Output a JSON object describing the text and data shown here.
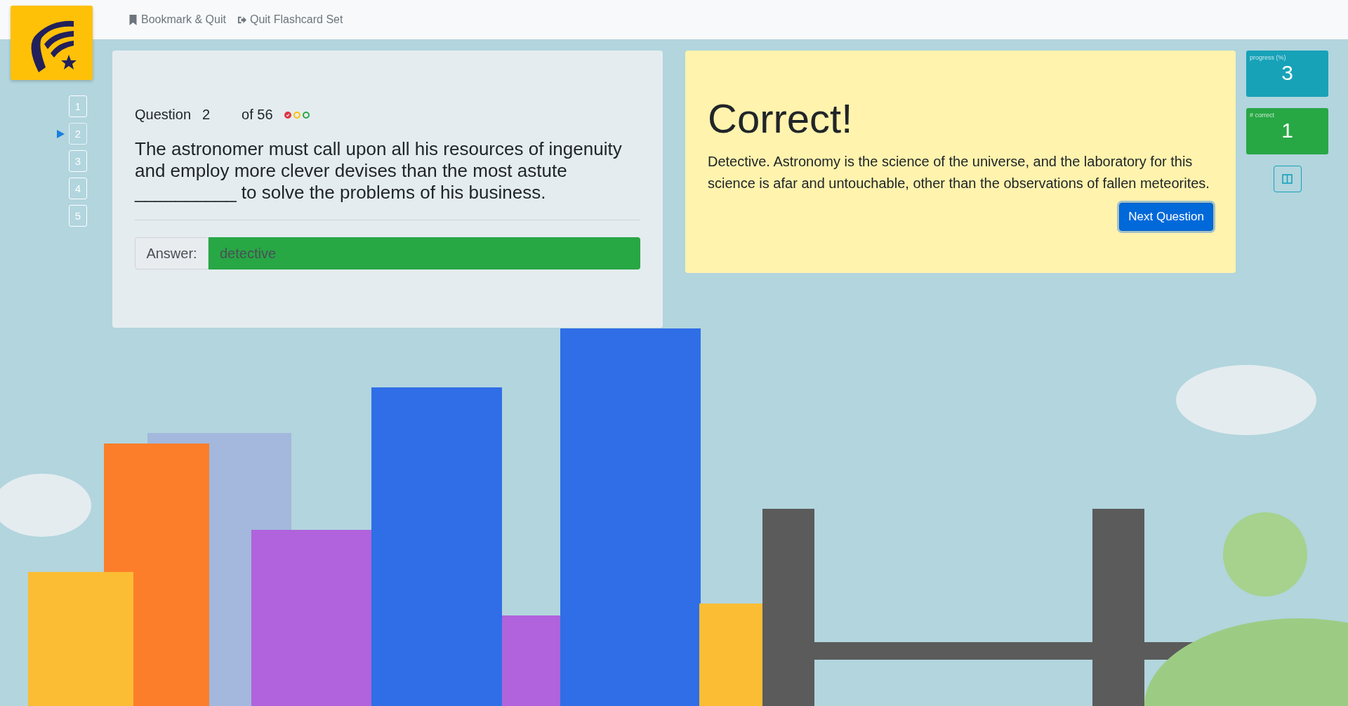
{
  "nav": [
    {
      "kind": "bookmark",
      "label": "Bookmark & Quit"
    },
    {
      "kind": "exit",
      "label": "Quit Flashcard Set"
    }
  ],
  "question_list": [
    {
      "label": "1",
      "selected": false
    },
    {
      "label": "2",
      "selected": true
    },
    {
      "label": "3",
      "selected": false
    },
    {
      "label": "4",
      "selected": false
    },
    {
      "label": "5",
      "selected": false
    }
  ],
  "question": {
    "label": "Question",
    "number": "2",
    "total": "of 56",
    "confidence": [
      {
        "color": "#dc3545",
        "selected": true
      },
      {
        "color": "#ffc107",
        "selected": false
      },
      {
        "color": "#28a745",
        "selected": false
      }
    ],
    "text": "The astronomer must call upon all his resources of ingenuity and employ more clever devises than the most astute __________ to solve the problems of his business.",
    "answer_label": "Answer:",
    "answer": "detective",
    "answer_correct": true
  },
  "feedback": {
    "title": "Correct!",
    "explanation": "Detective. Astronomy is the science of the universe, and the laboratory for this science is afar and untouchable, other than the observations of fallen meteorites.",
    "button": "Next Question"
  },
  "stats": [
    {
      "label": "progress (%)",
      "value": "3",
      "color": "#17a2b8"
    },
    {
      "label": "# correct",
      "value": "1",
      "color": "#28a745"
    }
  ]
}
